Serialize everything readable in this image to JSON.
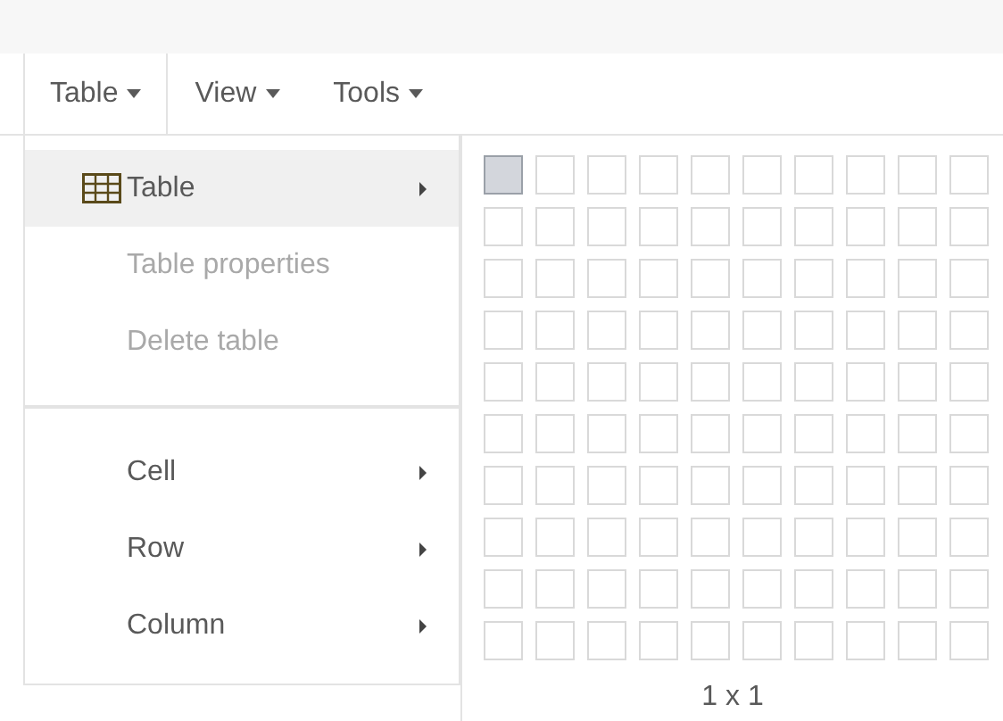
{
  "menubar": [
    {
      "label": "Table",
      "selected": true
    },
    {
      "label": "View",
      "selected": false
    },
    {
      "label": "Tools",
      "selected": false
    }
  ],
  "menu": {
    "items": [
      {
        "kind": "item",
        "label": "Table",
        "icon": true,
        "submenu": true,
        "selected": true,
        "disabled": false
      },
      {
        "kind": "item",
        "label": "Table properties",
        "icon": false,
        "submenu": false,
        "selected": false,
        "disabled": true
      },
      {
        "kind": "item",
        "label": "Delete table",
        "icon": false,
        "submenu": false,
        "selected": false,
        "disabled": true
      },
      {
        "kind": "divider"
      },
      {
        "kind": "item",
        "label": "Cell",
        "icon": false,
        "submenu": true,
        "selected": false,
        "disabled": false
      },
      {
        "kind": "item",
        "label": "Row",
        "icon": false,
        "submenu": true,
        "selected": false,
        "disabled": false
      },
      {
        "kind": "item",
        "label": "Column",
        "icon": false,
        "submenu": true,
        "selected": false,
        "disabled": false
      }
    ]
  },
  "grid_picker": {
    "rows": [
      {
        "cells": [
          {
            "selected": true
          },
          {
            "selected": false
          },
          {
            "selected": false
          },
          {
            "selected": false
          },
          {
            "selected": false
          },
          {
            "selected": false
          },
          {
            "selected": false
          },
          {
            "selected": false
          },
          {
            "selected": false
          },
          {
            "selected": false
          }
        ]
      },
      {
        "cells": [
          {
            "selected": false
          },
          {
            "selected": false
          },
          {
            "selected": false
          },
          {
            "selected": false
          },
          {
            "selected": false
          },
          {
            "selected": false
          },
          {
            "selected": false
          },
          {
            "selected": false
          },
          {
            "selected": false
          },
          {
            "selected": false
          }
        ]
      },
      {
        "cells": [
          {
            "selected": false
          },
          {
            "selected": false
          },
          {
            "selected": false
          },
          {
            "selected": false
          },
          {
            "selected": false
          },
          {
            "selected": false
          },
          {
            "selected": false
          },
          {
            "selected": false
          },
          {
            "selected": false
          },
          {
            "selected": false
          }
        ]
      },
      {
        "cells": [
          {
            "selected": false
          },
          {
            "selected": false
          },
          {
            "selected": false
          },
          {
            "selected": false
          },
          {
            "selected": false
          },
          {
            "selected": false
          },
          {
            "selected": false
          },
          {
            "selected": false
          },
          {
            "selected": false
          },
          {
            "selected": false
          }
        ]
      },
      {
        "cells": [
          {
            "selected": false
          },
          {
            "selected": false
          },
          {
            "selected": false
          },
          {
            "selected": false
          },
          {
            "selected": false
          },
          {
            "selected": false
          },
          {
            "selected": false
          },
          {
            "selected": false
          },
          {
            "selected": false
          },
          {
            "selected": false
          }
        ]
      },
      {
        "cells": [
          {
            "selected": false
          },
          {
            "selected": false
          },
          {
            "selected": false
          },
          {
            "selected": false
          },
          {
            "selected": false
          },
          {
            "selected": false
          },
          {
            "selected": false
          },
          {
            "selected": false
          },
          {
            "selected": false
          },
          {
            "selected": false
          }
        ]
      },
      {
        "cells": [
          {
            "selected": false
          },
          {
            "selected": false
          },
          {
            "selected": false
          },
          {
            "selected": false
          },
          {
            "selected": false
          },
          {
            "selected": false
          },
          {
            "selected": false
          },
          {
            "selected": false
          },
          {
            "selected": false
          },
          {
            "selected": false
          }
        ]
      },
      {
        "cells": [
          {
            "selected": false
          },
          {
            "selected": false
          },
          {
            "selected": false
          },
          {
            "selected": false
          },
          {
            "selected": false
          },
          {
            "selected": false
          },
          {
            "selected": false
          },
          {
            "selected": false
          },
          {
            "selected": false
          },
          {
            "selected": false
          }
        ]
      },
      {
        "cells": [
          {
            "selected": false
          },
          {
            "selected": false
          },
          {
            "selected": false
          },
          {
            "selected": false
          },
          {
            "selected": false
          },
          {
            "selected": false
          },
          {
            "selected": false
          },
          {
            "selected": false
          },
          {
            "selected": false
          },
          {
            "selected": false
          }
        ]
      },
      {
        "cells": [
          {
            "selected": false
          },
          {
            "selected": false
          },
          {
            "selected": false
          },
          {
            "selected": false
          },
          {
            "selected": false
          },
          {
            "selected": false
          },
          {
            "selected": false
          },
          {
            "selected": false
          },
          {
            "selected": false
          },
          {
            "selected": false
          }
        ]
      }
    ],
    "size_label": "1 x 1"
  }
}
